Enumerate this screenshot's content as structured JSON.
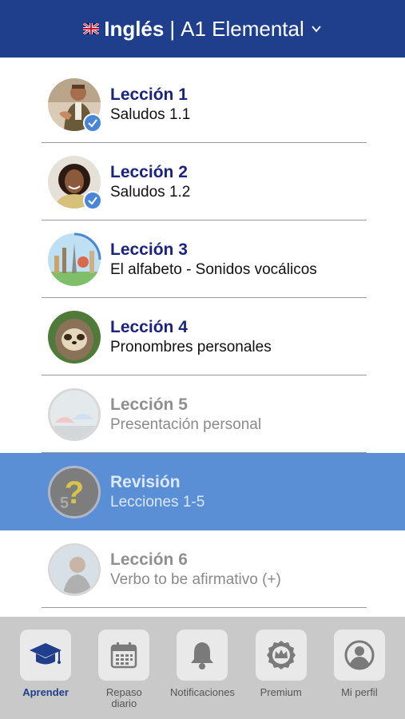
{
  "header": {
    "language": "Inglés",
    "level": "A1 Elemental",
    "flag_icon": "uk-flag-icon",
    "dropdown_icon": "chevron-down-icon",
    "background": "#1f3f8c"
  },
  "lessons": [
    {
      "title": "Lección 1",
      "subtitle": "Saludos 1.1",
      "status": "completed"
    },
    {
      "title": "Lección 2",
      "subtitle": "Saludos 1.2",
      "status": "completed"
    },
    {
      "title": "Lección 3",
      "subtitle": "El alfabeto - Sonidos vocálicos",
      "status": "in-progress"
    },
    {
      "title": "Lección 4",
      "subtitle": "Pronombres personales",
      "status": "available"
    },
    {
      "title": "Lección 5",
      "subtitle": "Presentación personal",
      "status": "locked"
    },
    {
      "title": "Revisión",
      "subtitle": "Lecciones 1-5",
      "status": "review"
    },
    {
      "title": "Lección 6",
      "subtitle": "Verbo to be afirmativo (+)",
      "status": "locked"
    }
  ],
  "bottom_nav": [
    {
      "label": "Aprender",
      "icon": "graduation-cap-icon",
      "active": true
    },
    {
      "label": "Repaso diario",
      "icon": "calendar-icon",
      "active": false
    },
    {
      "label": "Notificaciones",
      "icon": "bell-icon",
      "active": false
    },
    {
      "label": "Premium",
      "icon": "crown-badge-icon",
      "active": false
    },
    {
      "label": "Mi perfil",
      "icon": "user-profile-icon",
      "active": false
    }
  ],
  "colors": {
    "accent": "#1f3f8c",
    "review_bg": "#5a8fd6",
    "check": "#4a86d6"
  }
}
